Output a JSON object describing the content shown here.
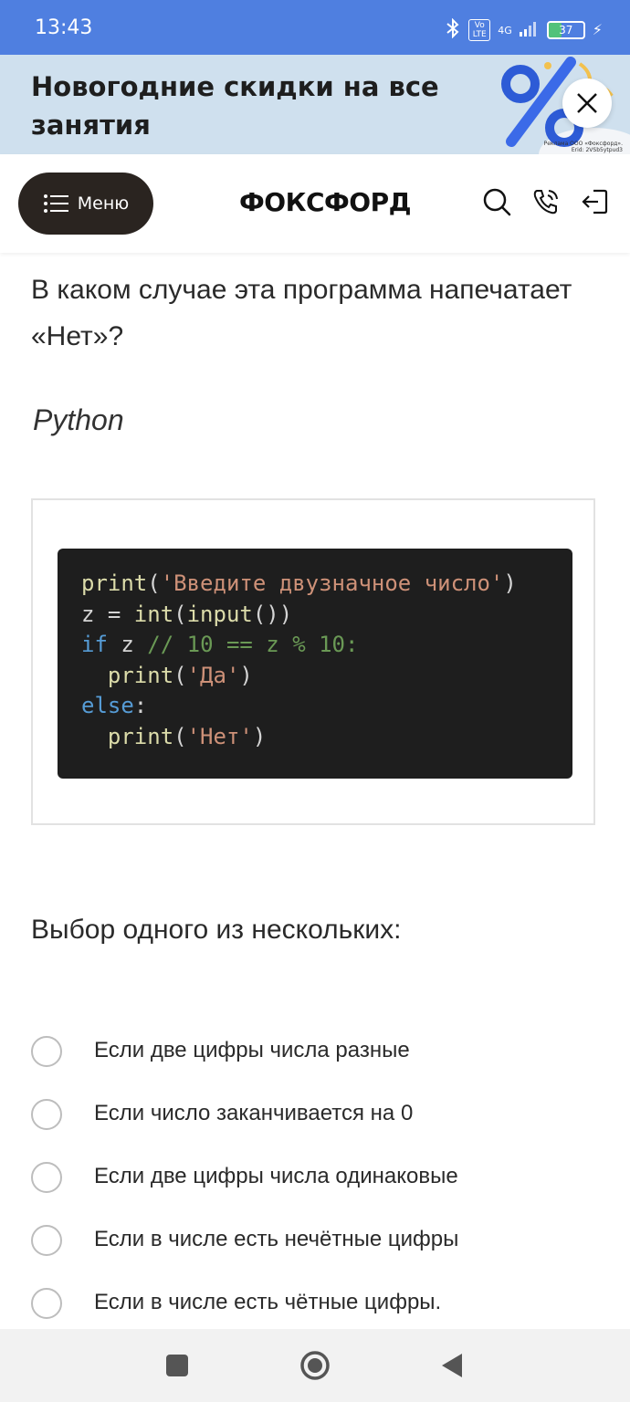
{
  "status_bar": {
    "time": "13:43",
    "network": "4G",
    "volte": "Vo LTE",
    "battery": "37"
  },
  "promo": {
    "title": "Новогодние скидки на все занятия",
    "legal": "Реклама ООО «Фоксфорд». Erid: 2VSb5ytpud3"
  },
  "header": {
    "menu_label": "Меню",
    "logo": "ФОКСФОРД"
  },
  "question": {
    "text": "В каком случае эта программа напечатает «Нет»?",
    "language": "Python"
  },
  "code": {
    "lines": [
      "print('Введите двузначное число')",
      "z = int(input())",
      "if z // 10 == z % 10:",
      "  print('Да')",
      "else:",
      "  print('Нет')"
    ]
  },
  "choices": {
    "header": "Выбор одного из нескольких:",
    "options": [
      "Если две цифры числа разные",
      "Если число заканчивается на 0",
      "Если две цифры числа одинаковые",
      "Если в числе есть нечётные цифры",
      "Если в числе есть чётные цифры."
    ]
  },
  "colors": {
    "status_bar": "#4f7fe0",
    "promo_bg": "#cfe0ee",
    "menu_button": "#2a2420",
    "code_bg": "#1e1e1e"
  }
}
